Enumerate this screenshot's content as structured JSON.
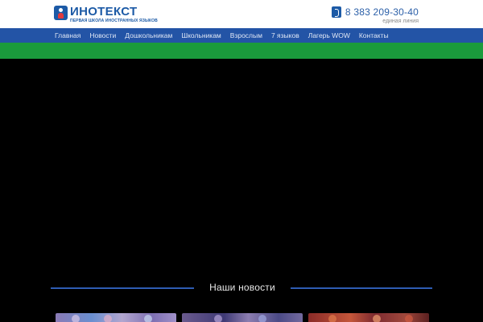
{
  "brand": {
    "name": "ИНОТЕКСТ",
    "tagline": "ПЕРВАЯ ШКОЛА ИНОСТРАННЫХ ЯЗЫКОВ",
    "color": "#1c5aa6",
    "icon": "logo-icon"
  },
  "contact": {
    "phone": "8 383 209-30-40",
    "phone_note": "единая линия",
    "icon": "phone-icon"
  },
  "nav": {
    "items": [
      {
        "label": "Главная"
      },
      {
        "label": "Новости"
      },
      {
        "label": "Дошкольникам"
      },
      {
        "label": "Школьникам"
      },
      {
        "label": "Взрослым"
      },
      {
        "label": "7 языков"
      },
      {
        "label": "Лагерь WOW"
      },
      {
        "label": "Контакты"
      }
    ],
    "bg_color": "#2354a6",
    "accent_color": "#1a9b3c"
  },
  "news": {
    "title": "Наши новости",
    "line_color": "#2e5cb3"
  }
}
